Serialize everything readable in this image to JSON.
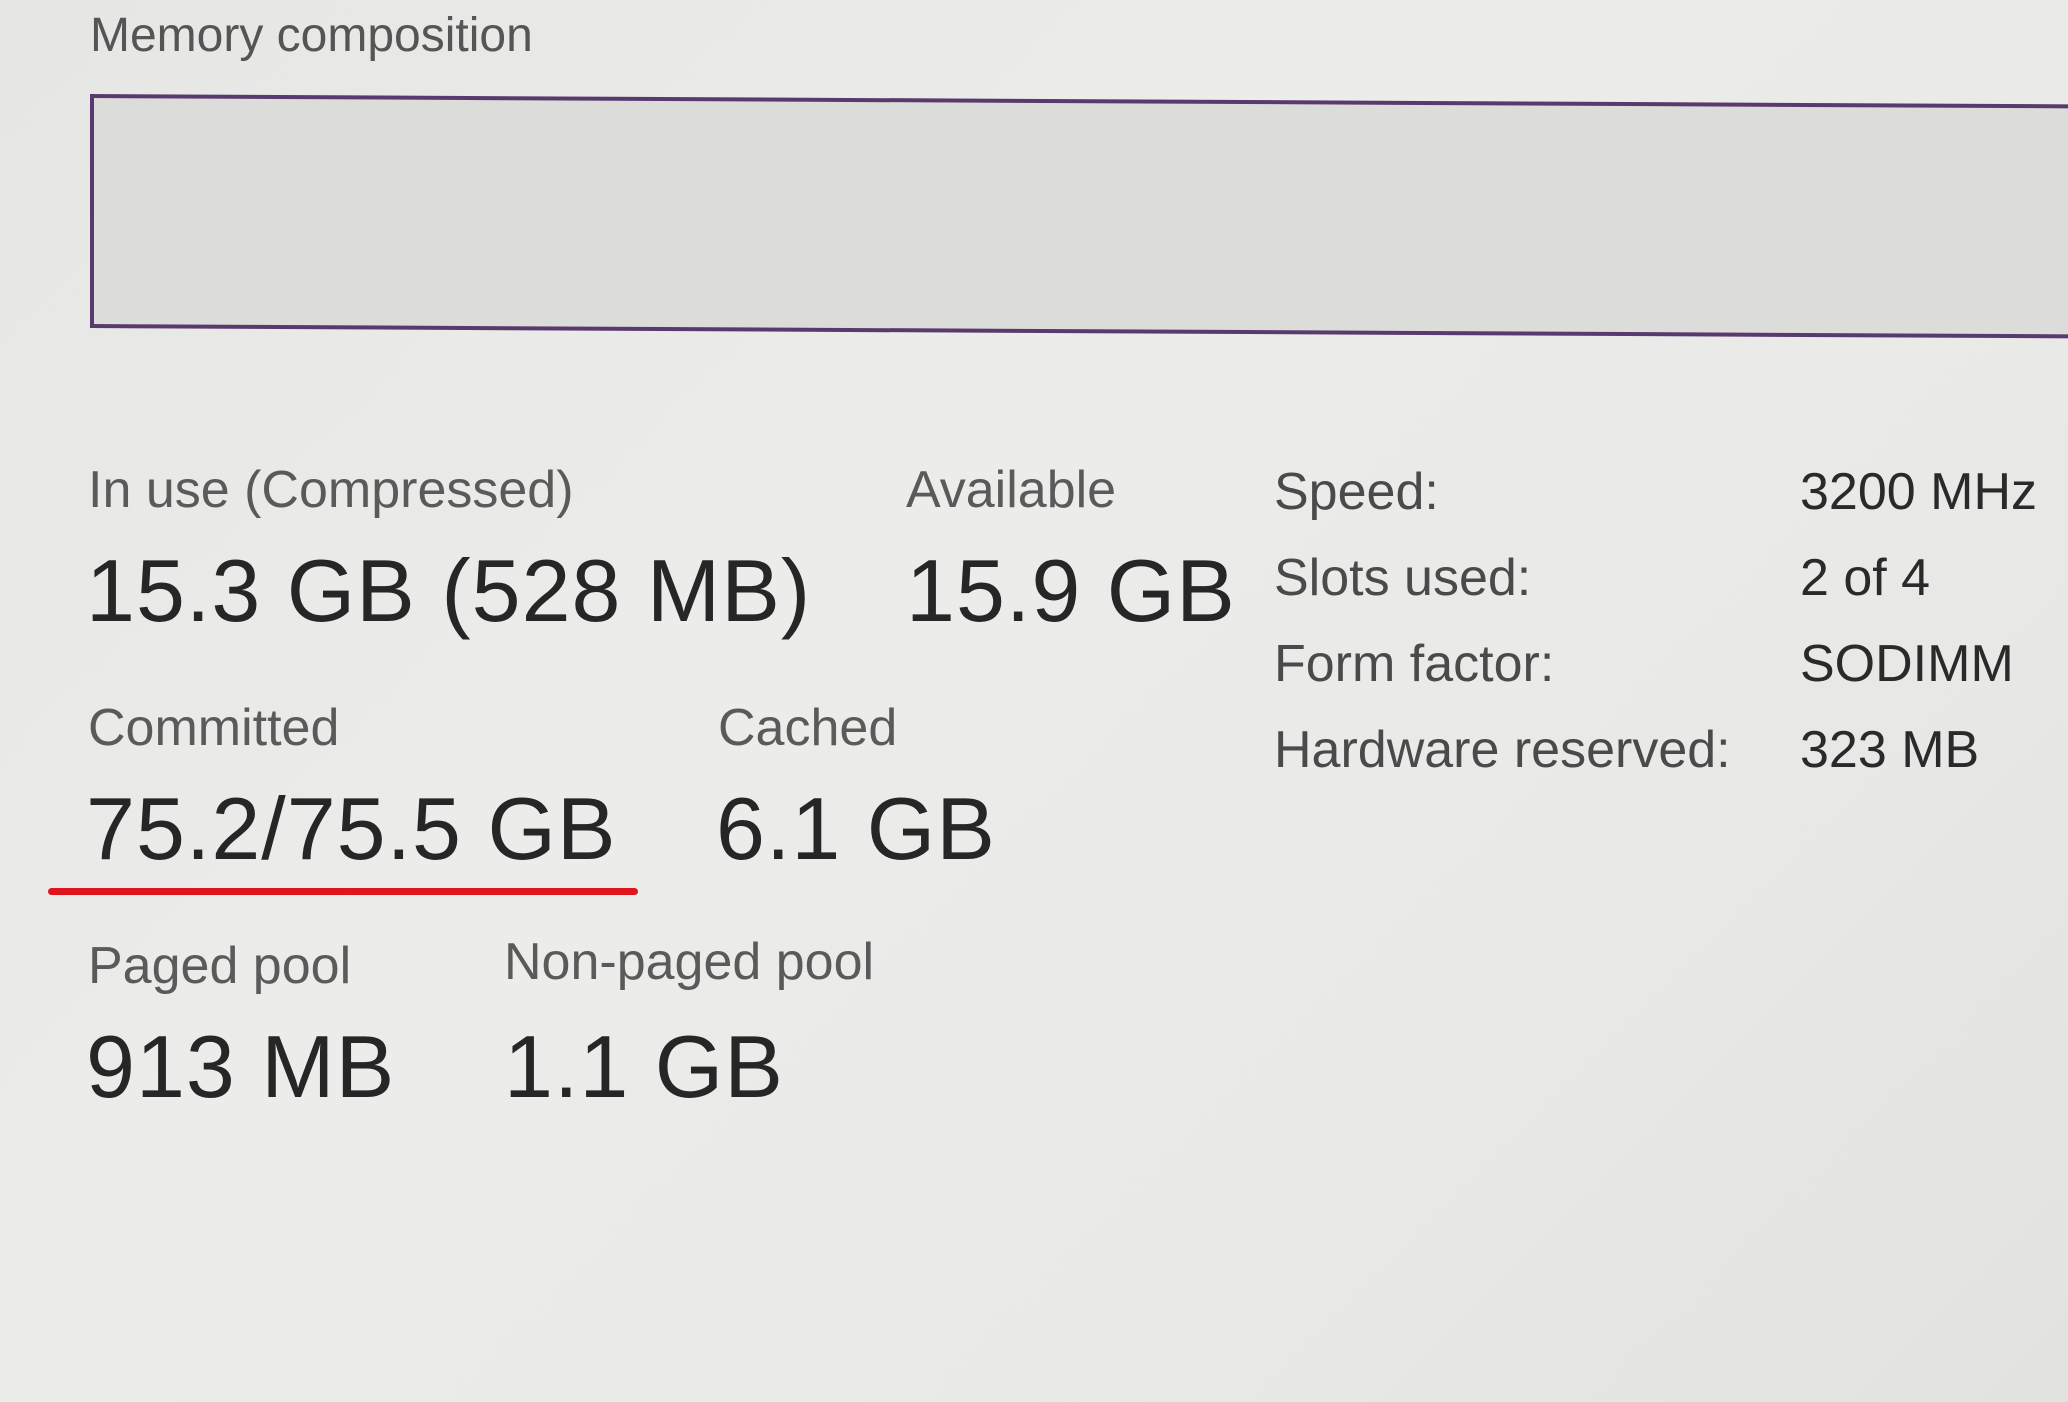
{
  "memory_composition": {
    "title": "Memory composition"
  },
  "stats": {
    "in_use": {
      "label": "In use (Compressed)",
      "value": "15.3 GB (528 MB)"
    },
    "available": {
      "label": "Available",
      "value": "15.9 GB"
    },
    "committed": {
      "label": "Committed",
      "value": "75.2/75.5 GB"
    },
    "cached": {
      "label": "Cached",
      "value": "6.1 GB"
    },
    "paged_pool": {
      "label": "Paged pool",
      "value": "913 MB"
    },
    "non_paged_pool": {
      "label": "Non-paged pool",
      "value": "1.1 GB"
    }
  },
  "hardware": {
    "speed": {
      "label": "Speed:",
      "value": "3200 MHz"
    },
    "slots_used": {
      "label": "Slots used:",
      "value": "2 of 4"
    },
    "form_factor": {
      "label": "Form factor:",
      "value": "SODIMM"
    },
    "hardware_reserved": {
      "label": "Hardware reserved:",
      "value": "323 MB"
    }
  },
  "colors": {
    "composition_border": "#5a3a6e",
    "highlight_underline": "#e0141c"
  }
}
